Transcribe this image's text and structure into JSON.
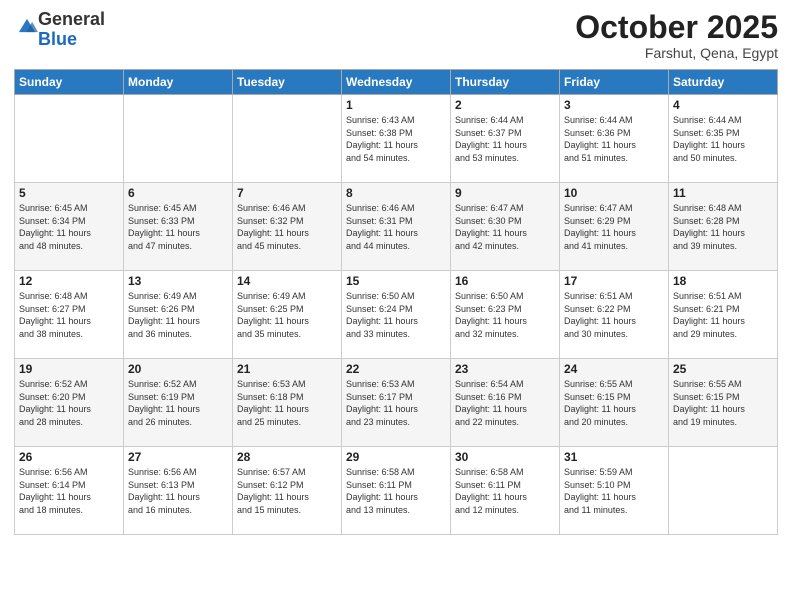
{
  "header": {
    "logo_general": "General",
    "logo_blue": "Blue",
    "month": "October 2025",
    "location": "Farshut, Qena, Egypt"
  },
  "days_of_week": [
    "Sunday",
    "Monday",
    "Tuesday",
    "Wednesday",
    "Thursday",
    "Friday",
    "Saturday"
  ],
  "weeks": [
    [
      {
        "day": "",
        "info": ""
      },
      {
        "day": "",
        "info": ""
      },
      {
        "day": "",
        "info": ""
      },
      {
        "day": "1",
        "info": "Sunrise: 6:43 AM\nSunset: 6:38 PM\nDaylight: 11 hours\nand 54 minutes."
      },
      {
        "day": "2",
        "info": "Sunrise: 6:44 AM\nSunset: 6:37 PM\nDaylight: 11 hours\nand 53 minutes."
      },
      {
        "day": "3",
        "info": "Sunrise: 6:44 AM\nSunset: 6:36 PM\nDaylight: 11 hours\nand 51 minutes."
      },
      {
        "day": "4",
        "info": "Sunrise: 6:44 AM\nSunset: 6:35 PM\nDaylight: 11 hours\nand 50 minutes."
      }
    ],
    [
      {
        "day": "5",
        "info": "Sunrise: 6:45 AM\nSunset: 6:34 PM\nDaylight: 11 hours\nand 48 minutes."
      },
      {
        "day": "6",
        "info": "Sunrise: 6:45 AM\nSunset: 6:33 PM\nDaylight: 11 hours\nand 47 minutes."
      },
      {
        "day": "7",
        "info": "Sunrise: 6:46 AM\nSunset: 6:32 PM\nDaylight: 11 hours\nand 45 minutes."
      },
      {
        "day": "8",
        "info": "Sunrise: 6:46 AM\nSunset: 6:31 PM\nDaylight: 11 hours\nand 44 minutes."
      },
      {
        "day": "9",
        "info": "Sunrise: 6:47 AM\nSunset: 6:30 PM\nDaylight: 11 hours\nand 42 minutes."
      },
      {
        "day": "10",
        "info": "Sunrise: 6:47 AM\nSunset: 6:29 PM\nDaylight: 11 hours\nand 41 minutes."
      },
      {
        "day": "11",
        "info": "Sunrise: 6:48 AM\nSunset: 6:28 PM\nDaylight: 11 hours\nand 39 minutes."
      }
    ],
    [
      {
        "day": "12",
        "info": "Sunrise: 6:48 AM\nSunset: 6:27 PM\nDaylight: 11 hours\nand 38 minutes."
      },
      {
        "day": "13",
        "info": "Sunrise: 6:49 AM\nSunset: 6:26 PM\nDaylight: 11 hours\nand 36 minutes."
      },
      {
        "day": "14",
        "info": "Sunrise: 6:49 AM\nSunset: 6:25 PM\nDaylight: 11 hours\nand 35 minutes."
      },
      {
        "day": "15",
        "info": "Sunrise: 6:50 AM\nSunset: 6:24 PM\nDaylight: 11 hours\nand 33 minutes."
      },
      {
        "day": "16",
        "info": "Sunrise: 6:50 AM\nSunset: 6:23 PM\nDaylight: 11 hours\nand 32 minutes."
      },
      {
        "day": "17",
        "info": "Sunrise: 6:51 AM\nSunset: 6:22 PM\nDaylight: 11 hours\nand 30 minutes."
      },
      {
        "day": "18",
        "info": "Sunrise: 6:51 AM\nSunset: 6:21 PM\nDaylight: 11 hours\nand 29 minutes."
      }
    ],
    [
      {
        "day": "19",
        "info": "Sunrise: 6:52 AM\nSunset: 6:20 PM\nDaylight: 11 hours\nand 28 minutes."
      },
      {
        "day": "20",
        "info": "Sunrise: 6:52 AM\nSunset: 6:19 PM\nDaylight: 11 hours\nand 26 minutes."
      },
      {
        "day": "21",
        "info": "Sunrise: 6:53 AM\nSunset: 6:18 PM\nDaylight: 11 hours\nand 25 minutes."
      },
      {
        "day": "22",
        "info": "Sunrise: 6:53 AM\nSunset: 6:17 PM\nDaylight: 11 hours\nand 23 minutes."
      },
      {
        "day": "23",
        "info": "Sunrise: 6:54 AM\nSunset: 6:16 PM\nDaylight: 11 hours\nand 22 minutes."
      },
      {
        "day": "24",
        "info": "Sunrise: 6:55 AM\nSunset: 6:15 PM\nDaylight: 11 hours\nand 20 minutes."
      },
      {
        "day": "25",
        "info": "Sunrise: 6:55 AM\nSunset: 6:15 PM\nDaylight: 11 hours\nand 19 minutes."
      }
    ],
    [
      {
        "day": "26",
        "info": "Sunrise: 6:56 AM\nSunset: 6:14 PM\nDaylight: 11 hours\nand 18 minutes."
      },
      {
        "day": "27",
        "info": "Sunrise: 6:56 AM\nSunset: 6:13 PM\nDaylight: 11 hours\nand 16 minutes."
      },
      {
        "day": "28",
        "info": "Sunrise: 6:57 AM\nSunset: 6:12 PM\nDaylight: 11 hours\nand 15 minutes."
      },
      {
        "day": "29",
        "info": "Sunrise: 6:58 AM\nSunset: 6:11 PM\nDaylight: 11 hours\nand 13 minutes."
      },
      {
        "day": "30",
        "info": "Sunrise: 6:58 AM\nSunset: 6:11 PM\nDaylight: 11 hours\nand 12 minutes."
      },
      {
        "day": "31",
        "info": "Sunrise: 5:59 AM\nSunset: 5:10 PM\nDaylight: 11 hours\nand 11 minutes."
      },
      {
        "day": "",
        "info": ""
      }
    ]
  ]
}
